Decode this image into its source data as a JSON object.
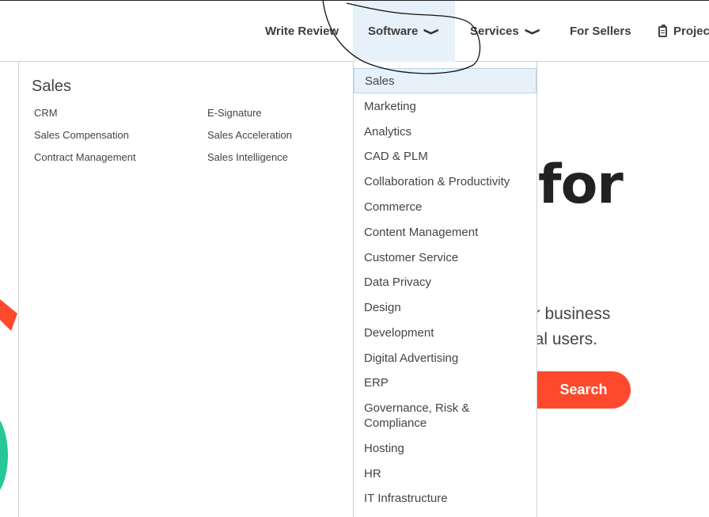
{
  "nav": {
    "write_review": "Write Review",
    "software": "Software",
    "services": "Services",
    "for_sellers": "For Sellers",
    "projects": "Projec",
    "chevron": "❯"
  },
  "mega": {
    "title": "Sales",
    "col1": [
      "CRM",
      "Sales Compensation",
      "Contract Management"
    ],
    "col2": [
      "E-Signature",
      "Sales Acceleration",
      "Sales Intelligence"
    ]
  },
  "hero": {
    "headline_fragment": "for",
    "line1": "ur business",
    "line2": "eal users.",
    "search_label": "Search"
  },
  "categories": [
    "Sales",
    "Marketing",
    "Analytics",
    "CAD & PLM",
    "Collaboration & Productivity",
    "Commerce",
    "Content Management",
    "Customer Service",
    "Data Privacy",
    "Design",
    "Development",
    "Digital Advertising",
    "ERP",
    "Governance, Risk & Compliance",
    "Hosting",
    "HR",
    "IT Infrastructure"
  ],
  "colors": {
    "accent": "#ff492c",
    "highlight": "#e7f1f9",
    "teal": "#27c79a"
  }
}
